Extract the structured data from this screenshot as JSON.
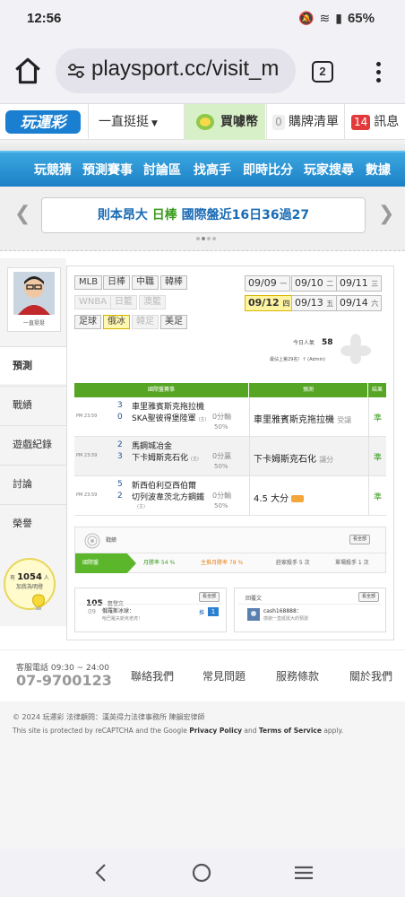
{
  "status": {
    "time": "12:56",
    "battery": "65%"
  },
  "browser": {
    "url": "playsport.cc/visit_m",
    "tab_count": "2"
  },
  "header": {
    "logo_text": "玩運彩",
    "user_menu": "一直挺挺",
    "buy_coin": "買噱幣",
    "cart_count": "0",
    "cart_label": "購牌清單",
    "msg_count": "14",
    "msg_label": "訊息"
  },
  "nav": [
    "玩競猜",
    "預測賽事",
    "討論區",
    "找高手",
    "即時比分",
    "玩家搜尋",
    "數據"
  ],
  "marquee": {
    "text_a": "則本昂大",
    "text_b": "日棒",
    "text_c": "國際盤近16日36過27"
  },
  "profile": {
    "name": "一直挺挺",
    "menu": [
      "預測",
      "戰績",
      "遊戲紀錄",
      "討論",
      "榮譽"
    ],
    "fans_prefix": "有",
    "fans_count": "1054",
    "fans_suffix": "人",
    "fans_note": "加我為明燈"
  },
  "sports": {
    "row1": [
      "MLB",
      "日棒",
      "中職",
      "韓棒"
    ],
    "row2": [
      "WNBA",
      "日籃",
      "澳籃"
    ],
    "row3": [
      "足球",
      "俄冰",
      "韓足",
      "美足"
    ]
  },
  "dates": [
    {
      "d": "09/09",
      "w": "一"
    },
    {
      "d": "09/10",
      "w": "二"
    },
    {
      "d": "09/11",
      "w": "三"
    },
    {
      "d": "09/12",
      "w": "四"
    },
    {
      "d": "09/13",
      "w": "五"
    },
    {
      "d": "09/14",
      "w": "六"
    }
  ],
  "today": {
    "label": "今日人氣",
    "count": "58",
    "rank": "最佔上第29名！↑ (Admin)"
  },
  "table": {
    "headers": [
      "國際盤賽事",
      "預測",
      "結果"
    ],
    "rows": [
      {
        "time": "PM 23:59",
        "n1": "3",
        "n2": "0",
        "team1": "車里雅賓斯克拖拉機",
        "team2": "SKA聖彼得堡陸軍",
        "sub": "(主)",
        "line": "0分輸",
        "pct": "50%",
        "pick": "車里雅賓斯克拖拉機",
        "pick_note": "受讓",
        "result": "準"
      },
      {
        "time": "PM 23:59",
        "n1": "2",
        "n2": "3",
        "team1": "馬鋼城冶金",
        "team2": "下卡姆斯克石化",
        "sub": "(主)",
        "line": "0分贏",
        "pct": "50%",
        "pick": "下卡姆斯克石化",
        "pick_note": "讓分",
        "result": "準"
      },
      {
        "time": "PM 23:59",
        "n1": "5",
        "n2": "2",
        "team1": "新西伯利亞西伯爾",
        "team2": "切列波韋茨北方鋼鐵",
        "sub": "(主)",
        "line": "0分輸",
        "pct": "50%",
        "pick": "4.5 大分",
        "pick_note": "",
        "result": "準"
      }
    ]
  },
  "record": {
    "title": "戰績",
    "all_btn": "看全部",
    "cells": [
      "國際盤",
      "月勝率 54 %",
      "主推月勝率 78 %",
      "莊家殺手 5 次",
      "單場殺手 1 次"
    ]
  },
  "posts": {
    "count": "105",
    "title": "篇發文",
    "all_btn": "看全部",
    "item_date": "09",
    "item_title": "俄羅斯冰球：",
    "item_sub": "哈巴羅夫斯克老虎！",
    "item_tag": "推",
    "item_num": "1"
  },
  "replies": {
    "title": "回覆文",
    "all_btn": "看全部",
    "user": "cash168888：",
    "text": "感謝一直挺挺大的預測"
  },
  "footer": {
    "service_label": "客服電話 09:30 ~ 24:00",
    "phone": "07-9700123",
    "links": [
      "聯絡我們",
      "常見問題",
      "服務條款",
      "關於我們"
    ],
    "copyright": "© 2024 玩運彩 法律顧問：漢英得力法律事務所 陳韻宏律師",
    "recaptcha_a": "This site is protected by reCAPTCHA and the Google ",
    "privacy": "Privacy Policy",
    "and": " and ",
    "terms": "Terms of Service",
    "apply": " apply."
  },
  "colors": {
    "nav_blue": "#1b80c6",
    "green": "#56a524",
    "accent_yellow": "#fff4a0"
  }
}
